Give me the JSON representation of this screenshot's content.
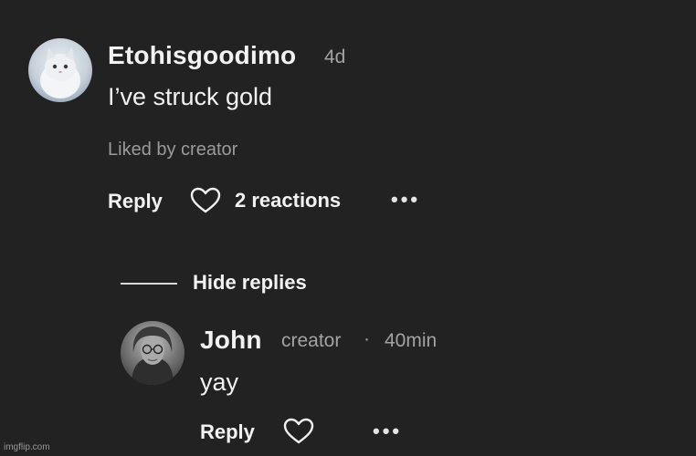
{
  "comment": {
    "username": "Etohisgoodimo",
    "time": "4d",
    "text": "I’ve struck gold",
    "liked_by": "Liked by creator",
    "reply_label": "Reply",
    "reactions_label": "2 reactions",
    "more_label": "•••"
  },
  "replies_toggle": {
    "label": "Hide replies"
  },
  "reply": {
    "username": "John",
    "badge": "creator",
    "separator": "·",
    "time": "40min",
    "text": "yay",
    "reply_label": "Reply",
    "more_label": "•••"
  },
  "watermark": "imgflip.com"
}
